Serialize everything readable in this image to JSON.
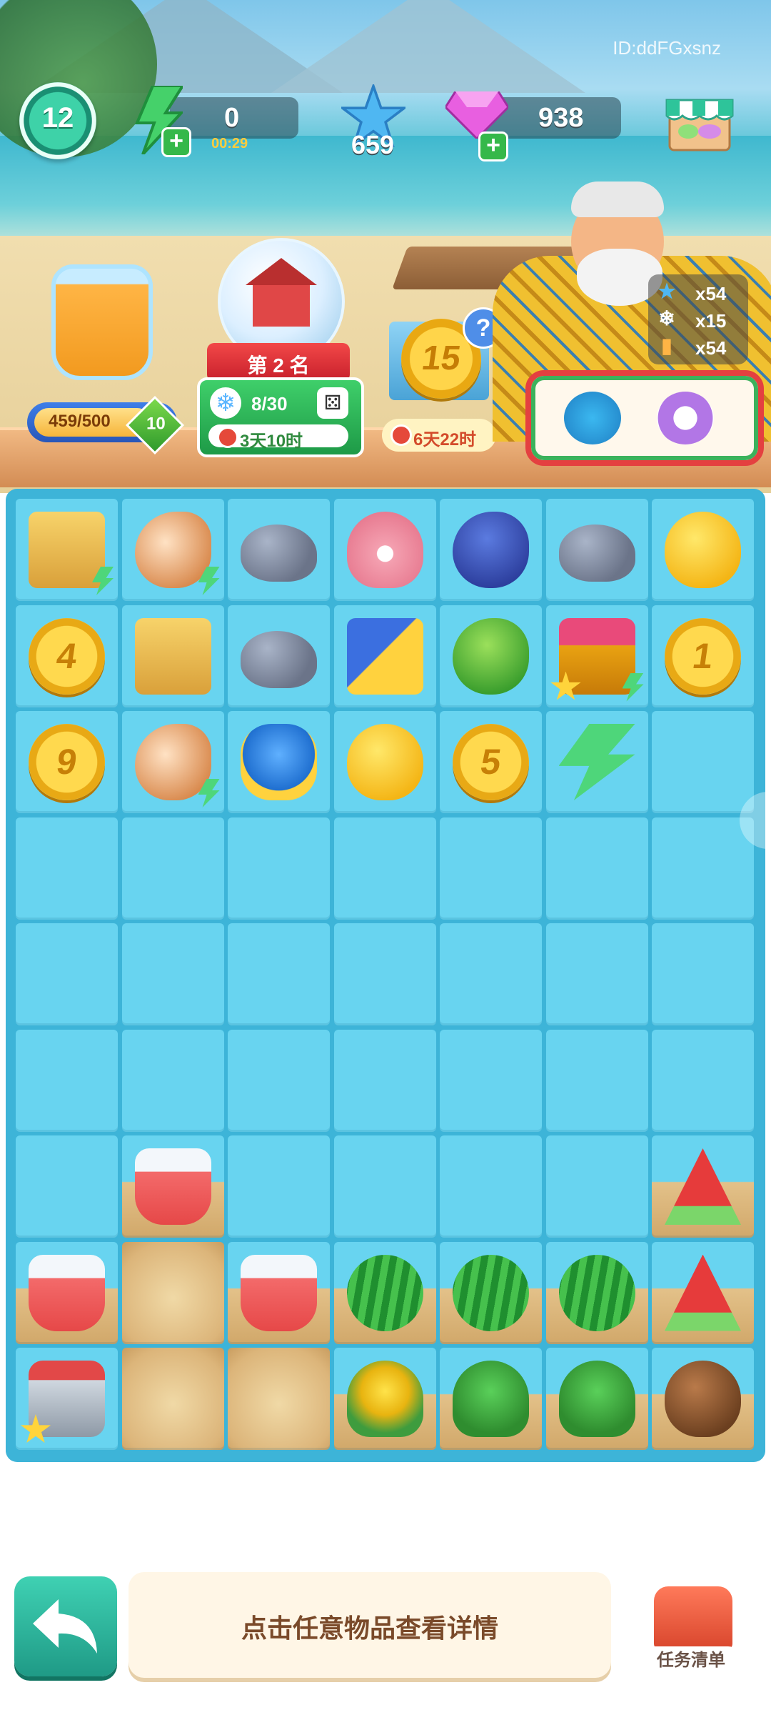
{
  "header": {
    "player_id": "ID:ddFGxsnz",
    "level": "12",
    "energy": "0",
    "energy_timer": "00:29",
    "stars": "659",
    "gems": "938"
  },
  "jar": {
    "progress_text": "459/500",
    "badge": "10"
  },
  "event": {
    "rank": "第 2 名",
    "count": "8/30",
    "time_left": "3天10时"
  },
  "coin_event": {
    "value": "15",
    "time_left": "6天22时",
    "help": "?"
  },
  "requirements": [
    {
      "icon": "star-icon",
      "count": "x54"
    },
    {
      "icon": "snowflake-icon",
      "count": "x15"
    },
    {
      "icon": "juice-icon",
      "count": "x54"
    }
  ],
  "board": {
    "coins": [
      "4",
      "1",
      "9",
      "5"
    ]
  },
  "bottom": {
    "hint": "点击任意物品查看详情",
    "tasks_label": "任务清单"
  },
  "colors": {
    "board": "#3db4d8",
    "cell": "#68d4f0",
    "accent_green": "#1f9a86",
    "hint_text": "#7a4a2a"
  }
}
